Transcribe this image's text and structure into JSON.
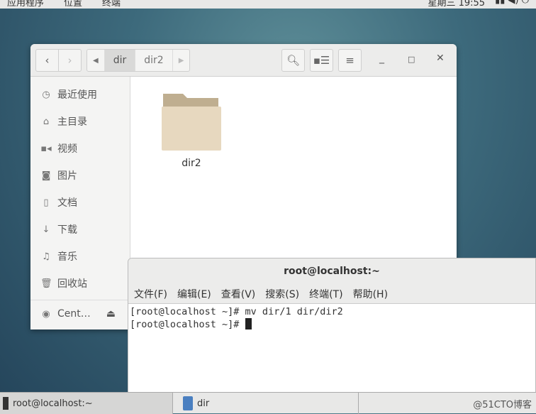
{
  "topbar": {
    "menus": [
      "应用程序",
      "位置",
      "终端"
    ],
    "clock": "星期三 19:55"
  },
  "filemanager": {
    "breadcrumb": [
      "dir",
      "dir2"
    ],
    "sidebar": [
      {
        "icon": "clock-icon",
        "label": "最近使用"
      },
      {
        "icon": "home-icon",
        "label": "主目录"
      },
      {
        "icon": "video-icon",
        "label": "视频"
      },
      {
        "icon": "camera-icon",
        "label": "图片"
      },
      {
        "icon": "document-icon",
        "label": "文档"
      },
      {
        "icon": "download-icon",
        "label": "下载"
      },
      {
        "icon": "music-icon",
        "label": "音乐"
      },
      {
        "icon": "trash-icon",
        "label": "回收站"
      }
    ],
    "device": "Cent…",
    "items": [
      {
        "name": "dir2"
      }
    ],
    "folder_color": "#d8c7a8"
  },
  "terminal": {
    "title": "root@localhost:~",
    "menu": [
      "文件(F)",
      "编辑(E)",
      "查看(V)",
      "搜索(S)",
      "终端(T)",
      "帮助(H)"
    ],
    "lines": [
      "[root@localhost ~]# mv dir/1 dir/dir2",
      "[root@localhost ~]# "
    ]
  },
  "taskbar": {
    "items": [
      "root@localhost:~",
      "dir"
    ],
    "watermark": "@51CTO博客"
  }
}
